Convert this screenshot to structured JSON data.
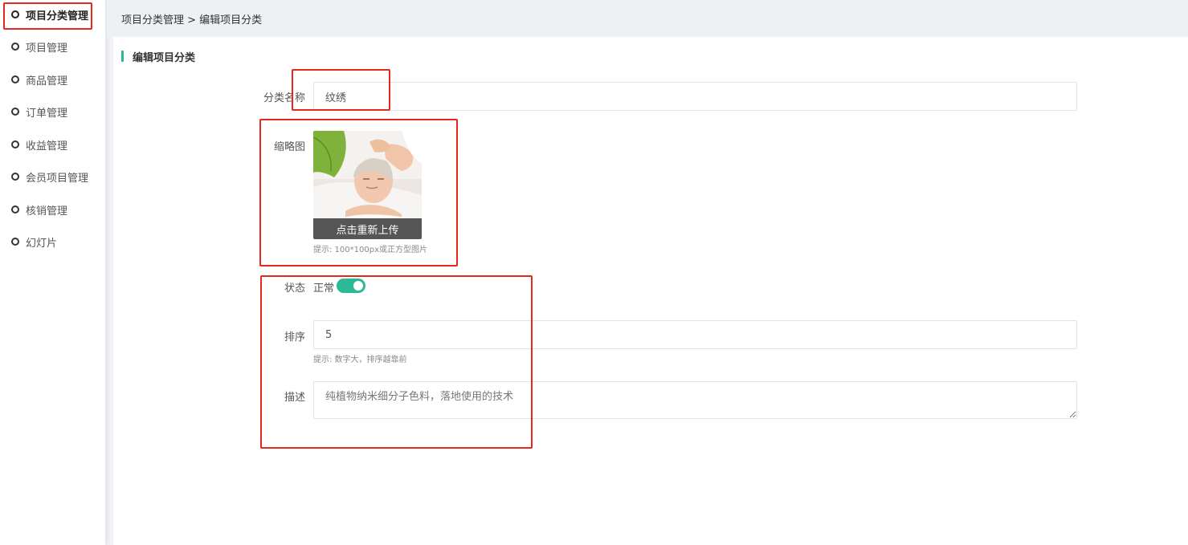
{
  "sidebar": {
    "items": [
      {
        "label": "项目分类管理",
        "active": true
      },
      {
        "label": "项目管理"
      },
      {
        "label": "商品管理"
      },
      {
        "label": "订单管理"
      },
      {
        "label": "收益管理"
      },
      {
        "label": "会员项目管理"
      },
      {
        "label": "核销管理"
      },
      {
        "label": "幻灯片"
      }
    ]
  },
  "header": {
    "breadcrumb": "项目分类管理 > 编辑项目分类"
  },
  "form": {
    "title": "编辑项目分类",
    "name_label": "分类名称",
    "name_value": "纹绣",
    "thumb_label": "缩略图",
    "thumb_overlay": "点击重新上传",
    "thumb_hint": "提示: 100*100px或正方型图片",
    "status_label": "状态",
    "status_value": "正常",
    "status_on": true,
    "sort_label": "排序",
    "sort_value": "5",
    "sort_hint": "提示: 数字大，排序越靠前",
    "desc_label": "描述",
    "desc_value": "纯植物纳米细分子色料，落地使用的技术"
  },
  "colors": {
    "accent": "#2bb996",
    "annotation": "#e8261c"
  }
}
